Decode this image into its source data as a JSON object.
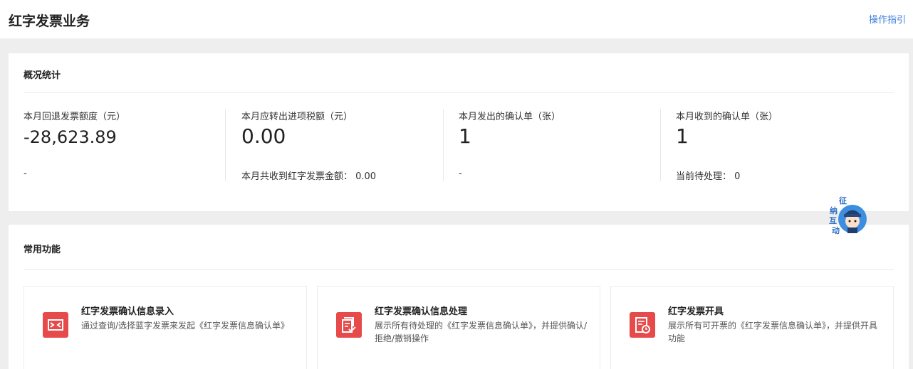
{
  "header": {
    "title": "红字发票业务",
    "guide_link": "操作指引"
  },
  "overview": {
    "title": "概况统计",
    "stats": [
      {
        "label": "本月回退发票额度（元）",
        "value": "-28,623.89",
        "sub": "-"
      },
      {
        "label": "本月应转出进项税额（元）",
        "value": "0.00",
        "sub": "本月共收到红字发票金额： 0.00"
      },
      {
        "label": "本月发出的确认单（张）",
        "value": "1",
        "sub": "-"
      },
      {
        "label": "本月收到的确认单（张）",
        "value": "1",
        "sub": "当前待处理： 0"
      }
    ]
  },
  "functions": {
    "title": "常用功能",
    "items": [
      {
        "icon": "arrows-exchange-icon",
        "title": "红字发票确认信息录入",
        "desc": "通过查询/选择蓝字发票来发起《红字发票信息确认单》"
      },
      {
        "icon": "document-check-icon",
        "title": "红字发票确认信息处理",
        "desc": "展示所有待处理的《红字发票信息确认单》，并提供确认/拒绝/撤销操作"
      },
      {
        "icon": "document-clock-icon",
        "title": "红字发票开具",
        "desc": "展示所有可开票的《红字发票信息确认单》，并提供开具功能"
      }
    ]
  },
  "mascot": {
    "chars": [
      "征",
      "纳",
      "互",
      "动"
    ],
    "icon": "assistant-mascot-icon"
  },
  "colors": {
    "accent_red": "#e64a4a",
    "link_blue": "#3f7fd9",
    "mascot_blue": "#3e8ee0"
  }
}
